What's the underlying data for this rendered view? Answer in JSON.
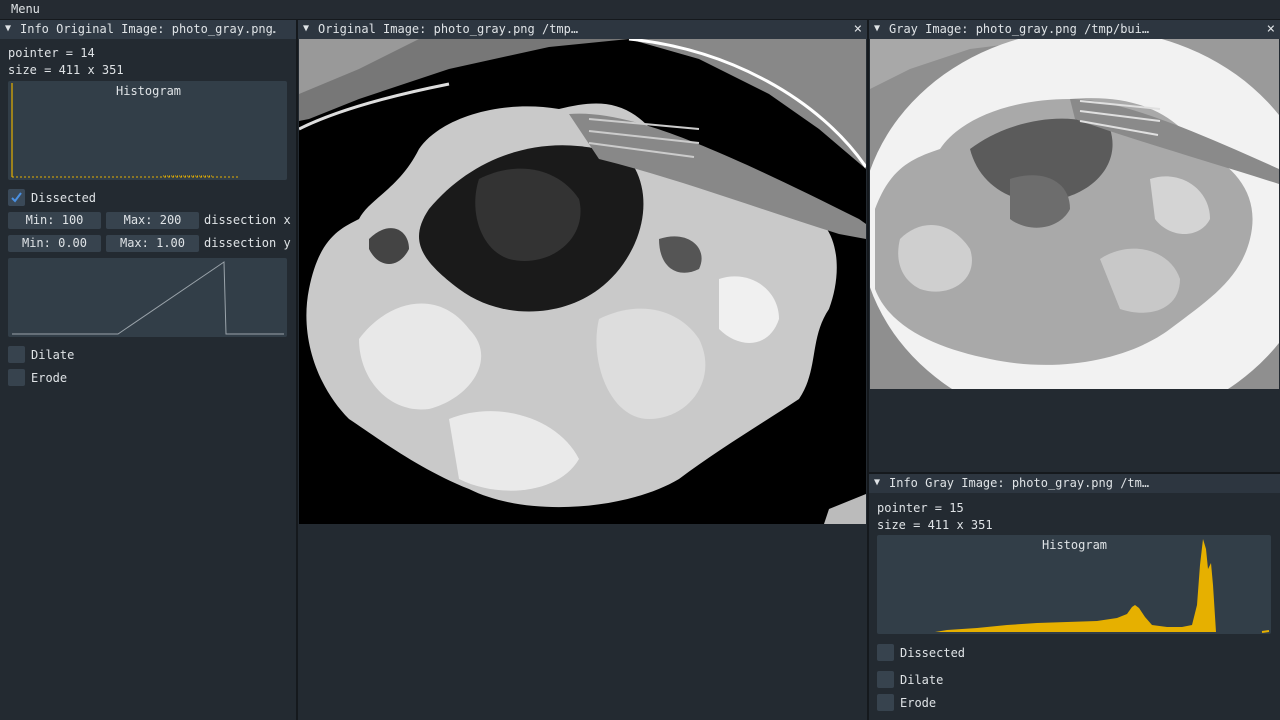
{
  "menubar": {
    "menu_label": "Menu"
  },
  "left_panel": {
    "title": "Info Original Image: photo_gray.png…",
    "pointer": "pointer = 14",
    "size": "size = 411 x 351",
    "histogram_label": "Histogram",
    "dissected_label": "Dissected",
    "dissected_checked": true,
    "min_x": "Min: 100",
    "max_x": "Max: 200",
    "dissection_x": "dissection x",
    "min_y": "Min: 0.00",
    "max_y": "Max: 1.00",
    "dissection_y": "dissection y",
    "dilate_label": "Dilate",
    "erode_label": "Erode"
  },
  "center_panel": {
    "title": "Original Image: photo_gray.png /tmp…",
    "close_icon": "×"
  },
  "right_panel": {
    "title": "Gray Image: photo_gray.png /tmp/bui…",
    "close_icon": "×"
  },
  "right_info": {
    "title": "Info Gray Image: photo_gray.png /tm…",
    "pointer": "pointer = 15",
    "size": "size = 411 x 351",
    "histogram_label": "Histogram",
    "dissected_label": "Dissected",
    "dilate_label": "Dilate",
    "erode_label": "Erode"
  },
  "colors": {
    "histogram": "#e6b000",
    "checkmark": "#4a90e2"
  },
  "icons": {
    "collapse": "collapse-triangle-icon",
    "close": "close-icon",
    "check": "checkmark-icon"
  }
}
